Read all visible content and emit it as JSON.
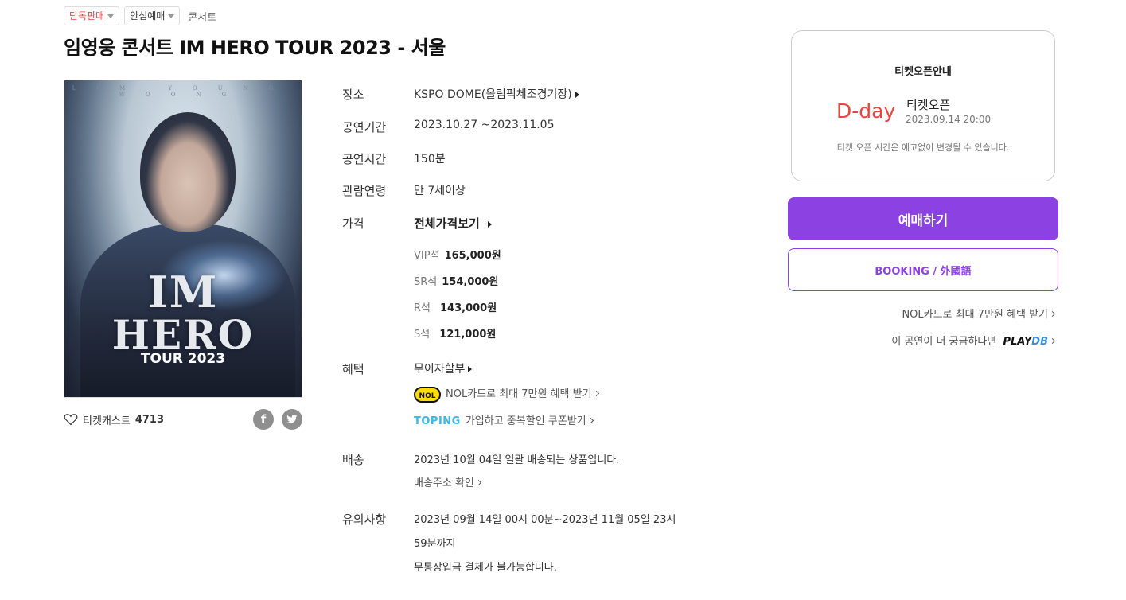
{
  "tags": {
    "exclusive": "단독판매",
    "safe": "안심예매",
    "genre": "콘서트"
  },
  "title": "임영웅 콘서트 IM HERO TOUR 2023 - 서울",
  "poster": {
    "top_text": "LIM YOUNG WOONG",
    "line1": "IM",
    "line2": "HERO",
    "line3": "TOUR 2023"
  },
  "cast": {
    "label": "티켓캐스트",
    "count": "4713"
  },
  "info": {
    "venue_label": "장소",
    "venue_value": "KSPO DOME(올림픽체조경기장)",
    "period_label": "공연기간",
    "period_value": "2023.10.27 ~2023.11.05",
    "runtime_label": "공연시간",
    "runtime_value": "150분",
    "age_label": "관람연령",
    "age_value": "만 7세이상",
    "price_label": "가격",
    "price_all": "전체가격보기",
    "prices": [
      {
        "seat": "VIP석",
        "amount": "165,000원"
      },
      {
        "seat": "SR석",
        "amount": "154,000원"
      },
      {
        "seat": "R석",
        "amount": "143,000원"
      },
      {
        "seat": "S석",
        "amount": "121,000원"
      }
    ],
    "benefit_label": "혜택",
    "benefit_installment": "무이자할부",
    "benefit_nol_logo": "NOL",
    "benefit_nol": "NOL카드로 최대 7만원 혜택 받기",
    "benefit_toping_logo": "TOPING",
    "benefit_toping": "가입하고 중복할인 쿠폰받기",
    "delivery_label": "배송",
    "delivery_value": "2023년 10월 04일 일괄 배송되는 상품입니다.",
    "delivery_link": "배송주소 확인",
    "notes_label": "유의사항",
    "notes_line1": "2023년 09월 14일 00시 00분~2023년 11월 05일 23시",
    "notes_line2": "59분까지",
    "notes_line3": "무통장입금 결제가 불가능합니다."
  },
  "notice": {
    "title": "티켓오픈안내",
    "dday": "D-day",
    "open_label": "티켓오픈",
    "open_datetime": "2023.09.14 20:00",
    "warning": "티켓 오픈 시간은 예고없이 변경될 수 있습니다."
  },
  "buttons": {
    "book": "예매하기",
    "foreign": "BOOKING / 外國語"
  },
  "right_links": {
    "nol": "NOL카드로 최대 7만원 혜택 받기",
    "playdb_prefix": "이 공연이 더 궁금하다면",
    "playdb_a": "PLAY",
    "playdb_b": "DB"
  },
  "colors": {
    "accent": "#8c41e3",
    "dday": "#e8453c",
    "exclusive": "#ef3e43"
  }
}
